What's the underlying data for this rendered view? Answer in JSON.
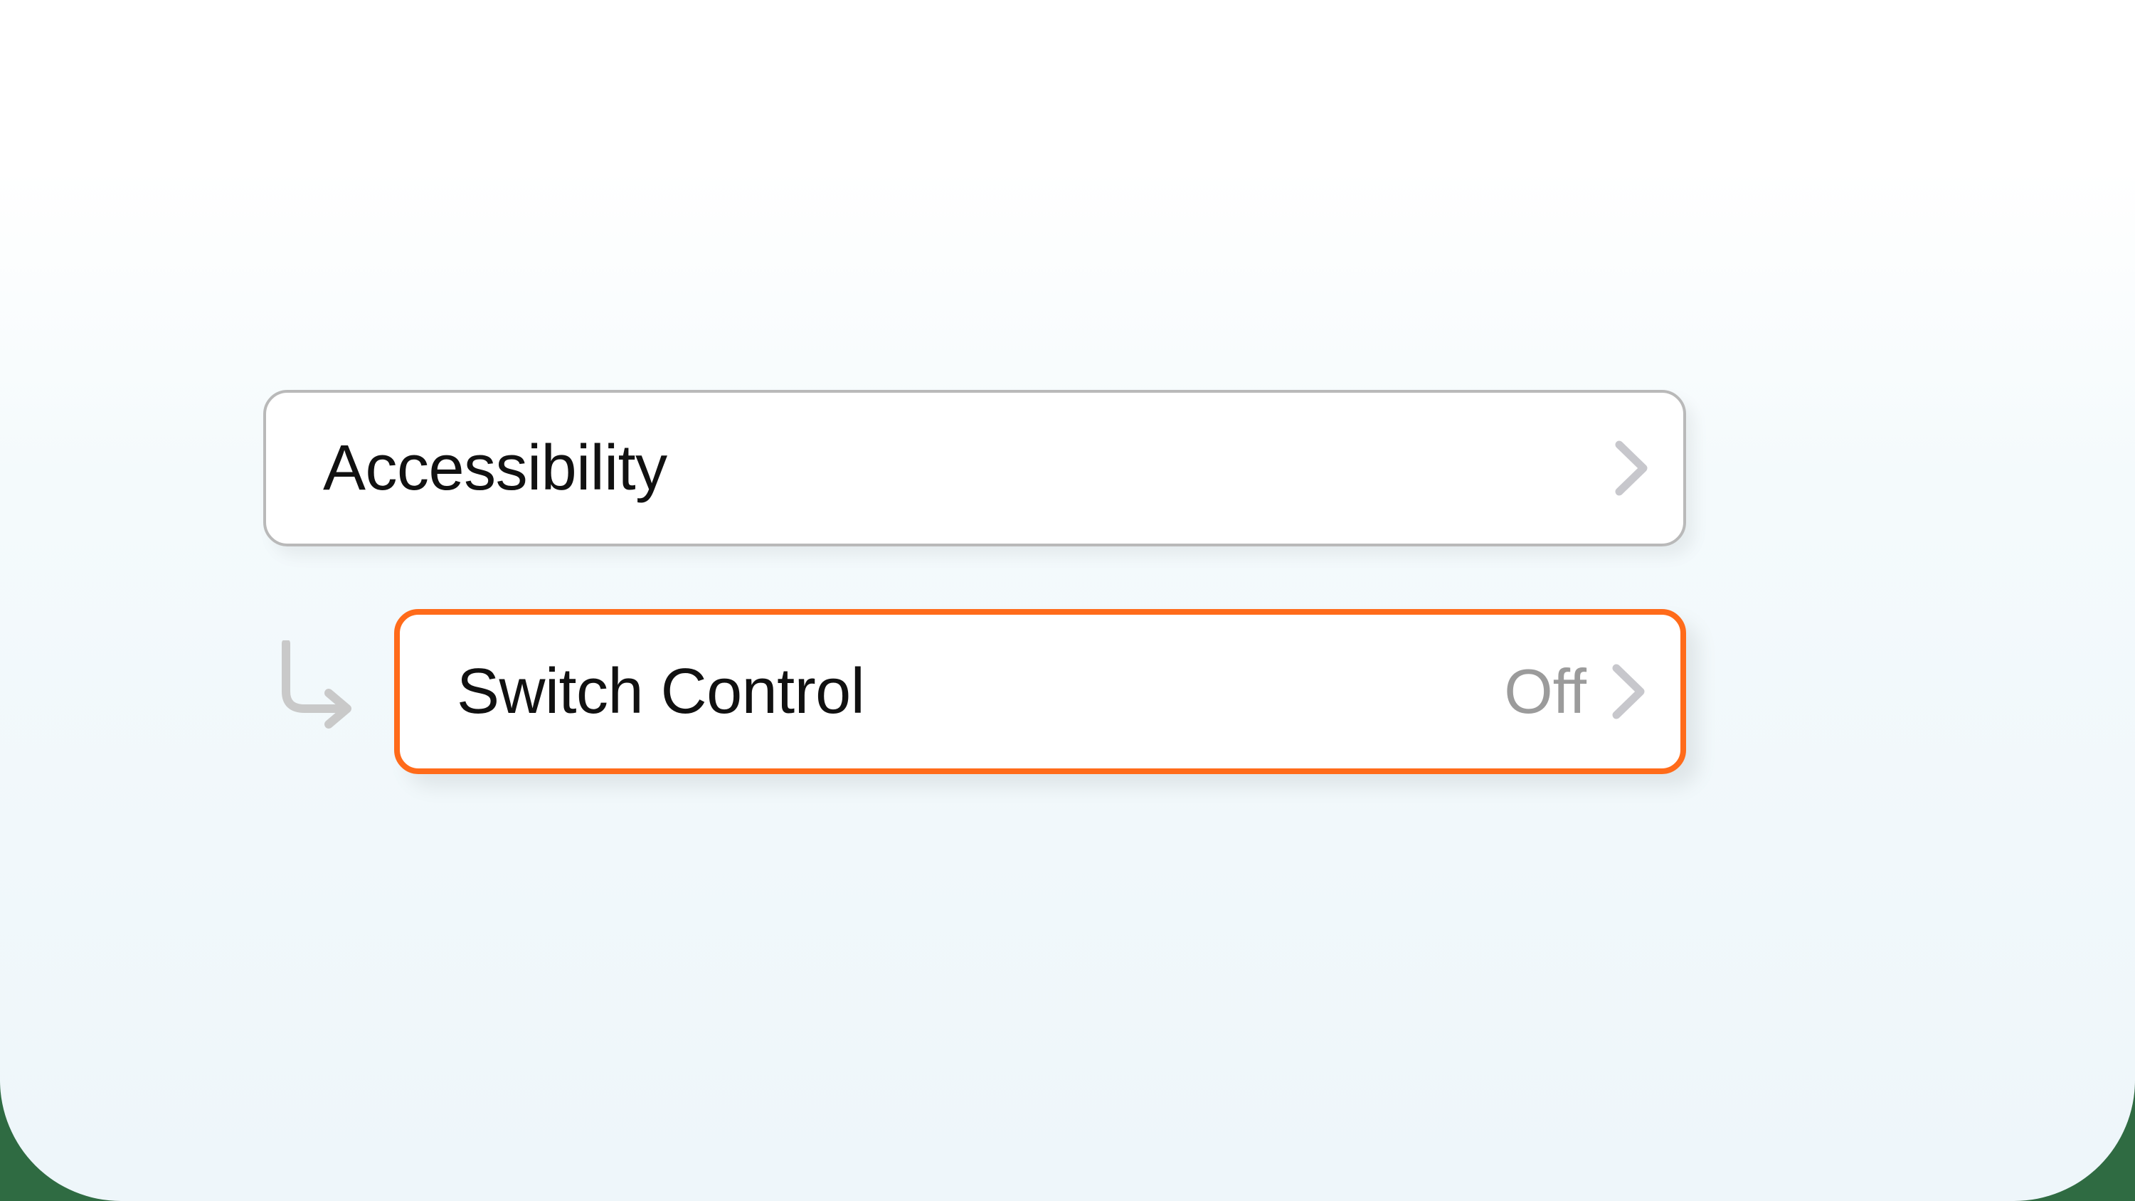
{
  "parent_row": {
    "label": "Accessibility"
  },
  "child_row": {
    "label": "Switch Control",
    "value": "Off"
  },
  "colors": {
    "highlight_border": "#ff6b1a",
    "muted_border": "#b9b9b9",
    "muted_text": "#9b9b9b"
  }
}
